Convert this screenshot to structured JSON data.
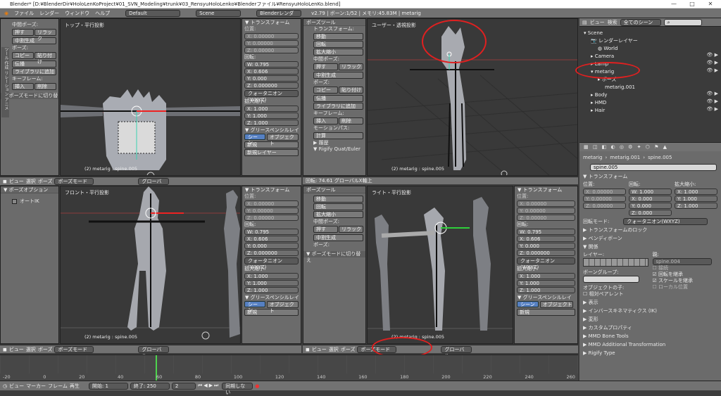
{
  "titlebar": {
    "text": "Blender* [D:¥BlenderDir¥HoloLenKoProject¥01_SVN_Modeling¥trunk¥03_RensyuHoloLenko¥Blenderファイル¥RensyuHoloLenKo.blend]"
  },
  "info": {
    "menus": [
      "ファイル",
      "レンダー",
      "ウィンドウ",
      "ヘルプ"
    ],
    "layout": "Default",
    "scene": "Scene",
    "engine": "Blenderレンダー",
    "stats": "v2.79 | ボーン:1/52 | メモリ:45.83M | metarig"
  },
  "tl": {
    "label": "トップ・平行投影",
    "info": "(2) metarig : spine.005",
    "tool_tab_label": "中間ポーズ:",
    "btn_push": "押す",
    "btn_relax": "リラック",
    "btn_between": "中割生成",
    "pose_label": "ポーズ:",
    "btn_copy": "コピー",
    "btn_paste": "貼り付け",
    "btn_inherit": "伝播",
    "btn_lib": "ライブラリに追加",
    "kf_label": "キーフレーム:",
    "btn_insert": "挿入",
    "btn_delete": "削除",
    "pose_toggle": "▼ ポーズモードに切り替え"
  },
  "tr": {
    "label": "ユーザー・透視投影",
    "info": "(2) metarig : spine.005",
    "info2": "回転: 74.61 グローバルX軸上",
    "tool_header": "ポーズツール",
    "transform_label": "トランスフォーム:",
    "btn_move": "移動",
    "btn_rotate": "回転",
    "btn_scale": "拡大縮小",
    "between_label": "中間ポーズ:",
    "btn_push": "押す",
    "btn_relax": "リラック",
    "btn_between": "中割生成",
    "pose_label": "ポーズ:",
    "btn_copy": "コピー",
    "btn_paste": "貼り付け",
    "btn_inherit": "伝播",
    "btn_lib": "ライブラリに追加",
    "kf_label": "キーフレーム:",
    "btn_insert": "挿入",
    "btn_delete": "削除",
    "motion_label": "モーションパス:",
    "btn_calc": "計算",
    "history": "▶ 履歴",
    "rigify": "▼ Rigify Quat/Euler"
  },
  "bl": {
    "label": "フロント・平行投影",
    "info": "(2) metarig : spine.005",
    "opt_header": "▼ ポーズオプション",
    "auto_ik": "オートIK"
  },
  "br": {
    "label": "ライト・平行投影",
    "info": "(2) metarig : spine.005",
    "tool_header": "ポーズツール",
    "btn_move": "移動",
    "btn_rotate": "回転",
    "btn_scale": "拡大縮小",
    "between_label": "中間ポーズ:",
    "btn_push": "押す",
    "btn_relax": "リラック",
    "btn_between": "中割生成",
    "pose_label": "ポーズ:",
    "pose_toggle": "▼ ポーズモードに切り替え"
  },
  "npanel": {
    "transform": "▼ トランスフォーム",
    "location": "位置:",
    "loc": [
      "X: 0.00000",
      "Y: 0.00000",
      "Z: 0.00000"
    ],
    "rotation": "回転:",
    "rot_w": "W: 0.795",
    "rot_x": "X: 0.606",
    "rot_y": "Y: 0.000",
    "rot_z": "Z: 0.000000",
    "mode": "クォータニオン(WXYZ)",
    "scale": "拡大縮小:",
    "sc_x": "X: 1.000",
    "sc_y": "Y: 1.000",
    "sc_z": "Z: 1.000",
    "grease": "▼ グリースペンシルレイ",
    "btn_scene": "シーン",
    "btn_object": "オブジェクト",
    "btn_new": "新規",
    "new_layer": "新規レイヤー"
  },
  "vpbar": {
    "view": "ビュー",
    "select": "選択",
    "pose": "ポーズ",
    "mode": "ポーズモード",
    "orient": "グローバル"
  },
  "outliner": {
    "view": "ビュー",
    "search": "検索",
    "scenes": "全てのシーン",
    "items": [
      "Scene",
      "レンダーレイヤー",
      "World",
      "Camera",
      "Lamp",
      "metarig",
      "ポーズ",
      "metarig.001",
      "Body",
      "HMD",
      "Hair"
    ]
  },
  "props": {
    "bc1": "metarig",
    "bc2": "metarig.001",
    "bc3": "spine.005",
    "bone_name": "spine.005",
    "transform": "▼ トランスフォーム",
    "loc_label": "位置:",
    "rot_label": "回転:",
    "sc_label": "拡大縮小:",
    "loc": [
      "X: 0.00000",
      "Y: 0.00000",
      "Z: 0.00000"
    ],
    "rot": [
      "W: 1.000",
      "X: 0.000",
      "Y: 0.000",
      "Z: 0.000"
    ],
    "sc": [
      "X: 1.000",
      "Y: 1.000",
      "Z: 1.000"
    ],
    "rot_mode_label": "回転モード:",
    "rot_mode": "クォータニオン(WXYZ)",
    "lock": "▶ トランスフォームのロック",
    "bendy": "▶ ベンディボーン",
    "relations": "▼ 関係",
    "layer": "レイヤー:",
    "parent": "親:",
    "parent_val": "spine.004",
    "connected": "接続",
    "bone_group": "ボーングループ:",
    "inherit_rot": "回転を継承",
    "inherit_sc": "スケールを継承",
    "local_loc": "ローカル位置",
    "obj_child": "オブジェクトの子:",
    "relative_parent": "相対ペアレント",
    "display": "▶ 表示",
    "ik": "▶ インバースキネマティクス (IK)",
    "deform": "▶ 変形",
    "custom": "▶ カスタムプロパティ",
    "mmd_bone": "▶ MMD Bone Tools",
    "mmd_add": "▶ MMD Additional Transformation",
    "rigify": "▶ Rigify Type"
  },
  "timeline": {
    "ticks": [
      "-20",
      "0",
      "20",
      "40",
      "60",
      "80",
      "100",
      "120",
      "140",
      "160",
      "180",
      "200",
      "220",
      "240",
      "260"
    ],
    "view": "ビュー",
    "marker": "マーカー",
    "frame": "フレーム",
    "play": "再生",
    "start": "開始:",
    "start_val": "1",
    "end": "終了:",
    "end_val": "250",
    "current": "2",
    "sync": "同期しない"
  },
  "colors": {
    "accent": "#5680c2",
    "annotation": "#e02020",
    "outliner_bg": "#3b3b3b",
    "panel": "#6b6b6b",
    "viewport": "#393939"
  }
}
